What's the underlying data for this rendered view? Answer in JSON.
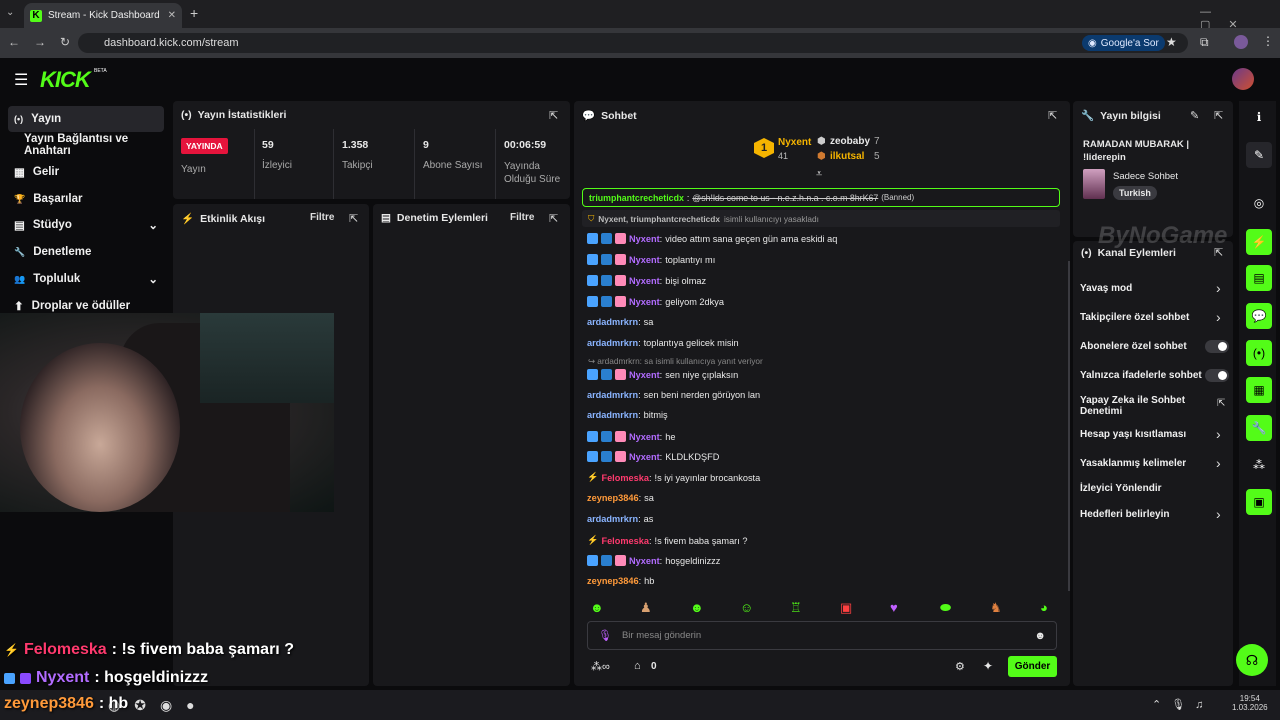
{
  "browser": {
    "tab_title": "Stream - Kick Dashboard",
    "url": "dashboard.kick.com/stream",
    "google_btn": "Google'a Sor",
    "new_tab": "+"
  },
  "app": {
    "logo": "KICK",
    "logo_tag": "BETA"
  },
  "sidebar": [
    {
      "label": "Yayın",
      "icon": "(•)"
    },
    {
      "label": "Yayın Bağlantısı ve Anahtarı",
      "icon": ""
    },
    {
      "label": "Gelir",
      "icon": "▦"
    },
    {
      "label": "Başarılar",
      "icon": "🏆"
    },
    {
      "label": "Stüdyo",
      "icon": "▤"
    },
    {
      "label": "Denetleme",
      "icon": "🔧"
    },
    {
      "label": "Topluluk",
      "icon": "👥"
    },
    {
      "label": "Droplar ve ödüller",
      "icon": "⬆"
    }
  ],
  "stats": {
    "title": "Yayın İstatistikleri",
    "live_badge": "YAYINDA",
    "live_label": "Yayın",
    "items": [
      {
        "value": "59",
        "label": "İzleyici"
      },
      {
        "value": "1.358",
        "label": "Takipçi"
      },
      {
        "value": "9",
        "label": "Abone Sayısı"
      },
      {
        "value": "00:06:59",
        "label": "Yayında Olduğu Süre"
      }
    ]
  },
  "activity": {
    "title": "Etkinlik Akışı",
    "filter": "Filtre"
  },
  "moderation": {
    "title": "Denetim Eylemleri",
    "filter": "Filtre"
  },
  "chat": {
    "title": "Sohbet",
    "leader1": {
      "rank": "1",
      "name": "Nyxent",
      "value": "41"
    },
    "leader2": {
      "name": "zeobaby",
      "value": "7"
    },
    "leader3": {
      "name": "ilkutsal",
      "value": "5"
    },
    "banned_user": "triumphantcrecheticdx",
    "banned_text": "@sh!lds come to us - n.e.z.h.n.a . c.o.m 8hrK67",
    "banned_tag": "(Banned)",
    "ban_notice_user": "Nyxent, triumphantcrecheticdx",
    "ban_notice_text": "isimli kullanıcıyı yasakladı",
    "reply_hint": "ardadmrkrn: sa isimli kullanıcıya yanıt veriyor",
    "messages": [
      {
        "user": "Nyxent",
        "text": "video attım sana geçen gün ama eskidi aq",
        "type": "nyx"
      },
      {
        "user": "Nyxent",
        "text": "toplantıyı mı",
        "type": "nyx"
      },
      {
        "user": "Nyxent",
        "text": "bişi olmaz",
        "type": "nyx"
      },
      {
        "user": "Nyxent",
        "text": "geliyom 2dkya",
        "type": "nyx"
      },
      {
        "user": "ardadmrkrn",
        "text": "sa",
        "type": "arda"
      },
      {
        "user": "ardadmrkrn",
        "text": "toplantıya gelicek misin",
        "type": "arda"
      },
      {
        "user": "Nyxent",
        "text": "sen niye çıplaksın",
        "type": "nyx"
      },
      {
        "user": "ardadmrkrn",
        "text": "sen beni nerden görüyon lan",
        "type": "arda"
      },
      {
        "user": "ardadmrkrn",
        "text": "bitmiş",
        "type": "arda"
      },
      {
        "user": "Nyxent",
        "text": "he",
        "type": "nyx"
      },
      {
        "user": "Nyxent",
        "text": "KLDLKDŞFD",
        "type": "nyx"
      },
      {
        "user": "Felomeska",
        "text": "!s iyi yayınlar brocankosta",
        "type": "felo"
      },
      {
        "user": "zeynep3846",
        "text": "sa",
        "type": "zey"
      },
      {
        "user": "ardadmrkrn",
        "text": "as",
        "type": "arda"
      },
      {
        "user": "Felomeska",
        "text": "!s fivem baba şamarı ?",
        "type": "felo"
      },
      {
        "user": "Nyxent",
        "text": "hoşgeldinizzz",
        "type": "nyx"
      },
      {
        "user": "zeynep3846",
        "text": "hb",
        "type": "zey"
      }
    ],
    "input_placeholder": "Bir mesaj gönderin",
    "points": "0",
    "send": "Gönder"
  },
  "info": {
    "title": "Yayın bilgisi",
    "stream_title": "RAMADAN MUBARAK | !liderepin",
    "category": "Sadece Sohbet",
    "tag": "Turkish"
  },
  "channel": {
    "title": "Kanal Eylemleri",
    "watermark": "ByNoGame",
    "items": [
      {
        "label": "Yavaş mod",
        "control": "chevron"
      },
      {
        "label": "Takipçilere özel sohbet",
        "control": "chevron"
      },
      {
        "label": "Abonelere özel sohbet",
        "control": "toggle"
      },
      {
        "label": "Yalnızca ifadelerle sohbet",
        "control": "toggle"
      },
      {
        "label": "Yapay Zeka ile Sohbet Denetimi",
        "control": "external"
      },
      {
        "label": "Hesap yaşı kısıtlaması",
        "control": "chevron"
      },
      {
        "label": "Yasaklanmış kelimeler",
        "control": "chevron"
      },
      {
        "label": "İzleyici Yönlendir",
        "control": "none"
      },
      {
        "label": "Hedefleri belirleyin",
        "control": "chevron"
      }
    ]
  },
  "overlay": [
    {
      "user": "Felomeska",
      "text": ": !s fivem baba şamarı ?"
    },
    {
      "user": "Nyxent",
      "text": ": hoşgeldinizzz"
    },
    {
      "user": "zeynep3846",
      "text": ": hb"
    }
  ],
  "taskbar": {
    "time": "19:54",
    "date": "1.03.2026"
  }
}
